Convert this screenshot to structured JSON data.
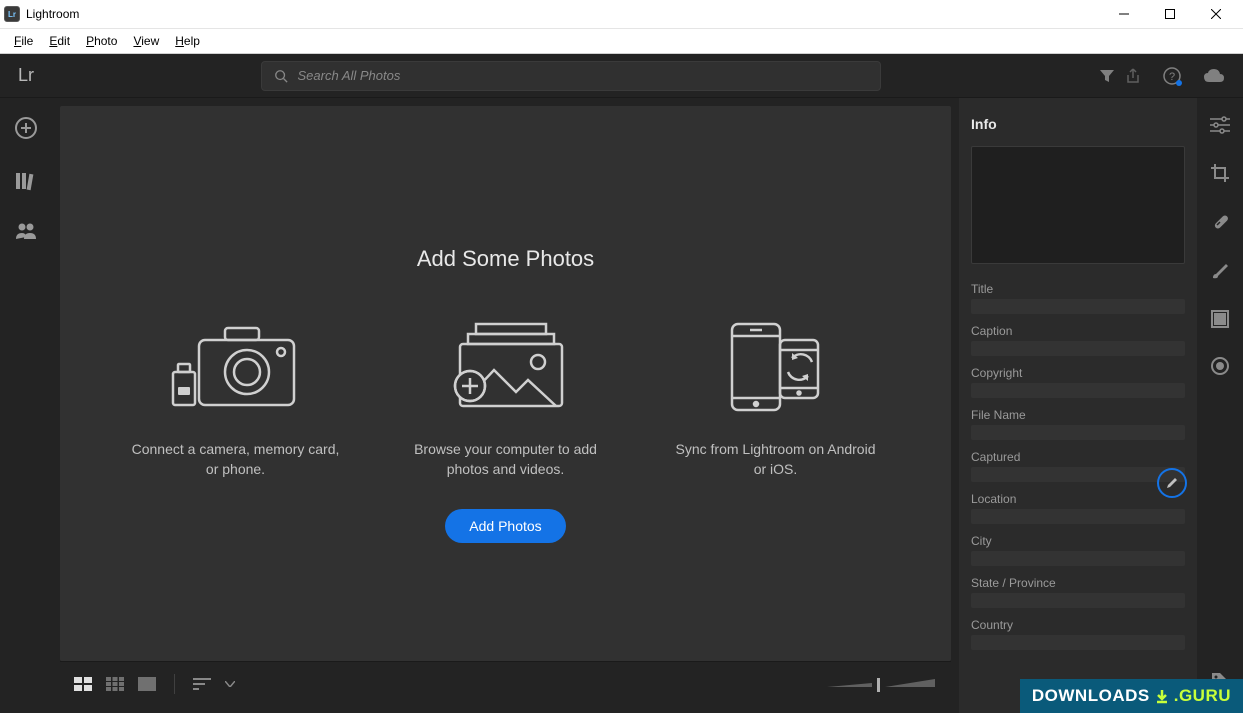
{
  "window": {
    "title": "Lightroom",
    "logo_text": "Lr"
  },
  "menubar": {
    "items": [
      {
        "label": "File",
        "u": "F"
      },
      {
        "label": "Edit",
        "u": "E"
      },
      {
        "label": "Photo",
        "u": "P"
      },
      {
        "label": "View",
        "u": "V"
      },
      {
        "label": "Help",
        "u": "H"
      }
    ]
  },
  "topbar": {
    "logo": "Lr",
    "search_placeholder": "Search All Photos"
  },
  "leftrail": {
    "items": [
      "add",
      "library",
      "people"
    ]
  },
  "main": {
    "heading": "Add Some Photos",
    "options": [
      {
        "id": "camera",
        "text": "Connect a camera, memory card, or phone."
      },
      {
        "id": "browse",
        "text": "Browse your computer to add photos and videos."
      },
      {
        "id": "sync",
        "text": "Sync from Lightroom on Android or iOS."
      }
    ],
    "primary_button": "Add Photos"
  },
  "info_panel": {
    "title": "Info",
    "fields": [
      "Title",
      "Caption",
      "Copyright",
      "File Name",
      "Captured",
      "Location",
      "City",
      "State / Province",
      "Country"
    ]
  },
  "rightrail": {
    "tools": [
      "adjust",
      "crop",
      "healing",
      "brush",
      "linear",
      "radial"
    ],
    "bottom": [
      "tag"
    ]
  },
  "watermark": {
    "left": "DOWNLOADS",
    "right": ".GURU"
  }
}
